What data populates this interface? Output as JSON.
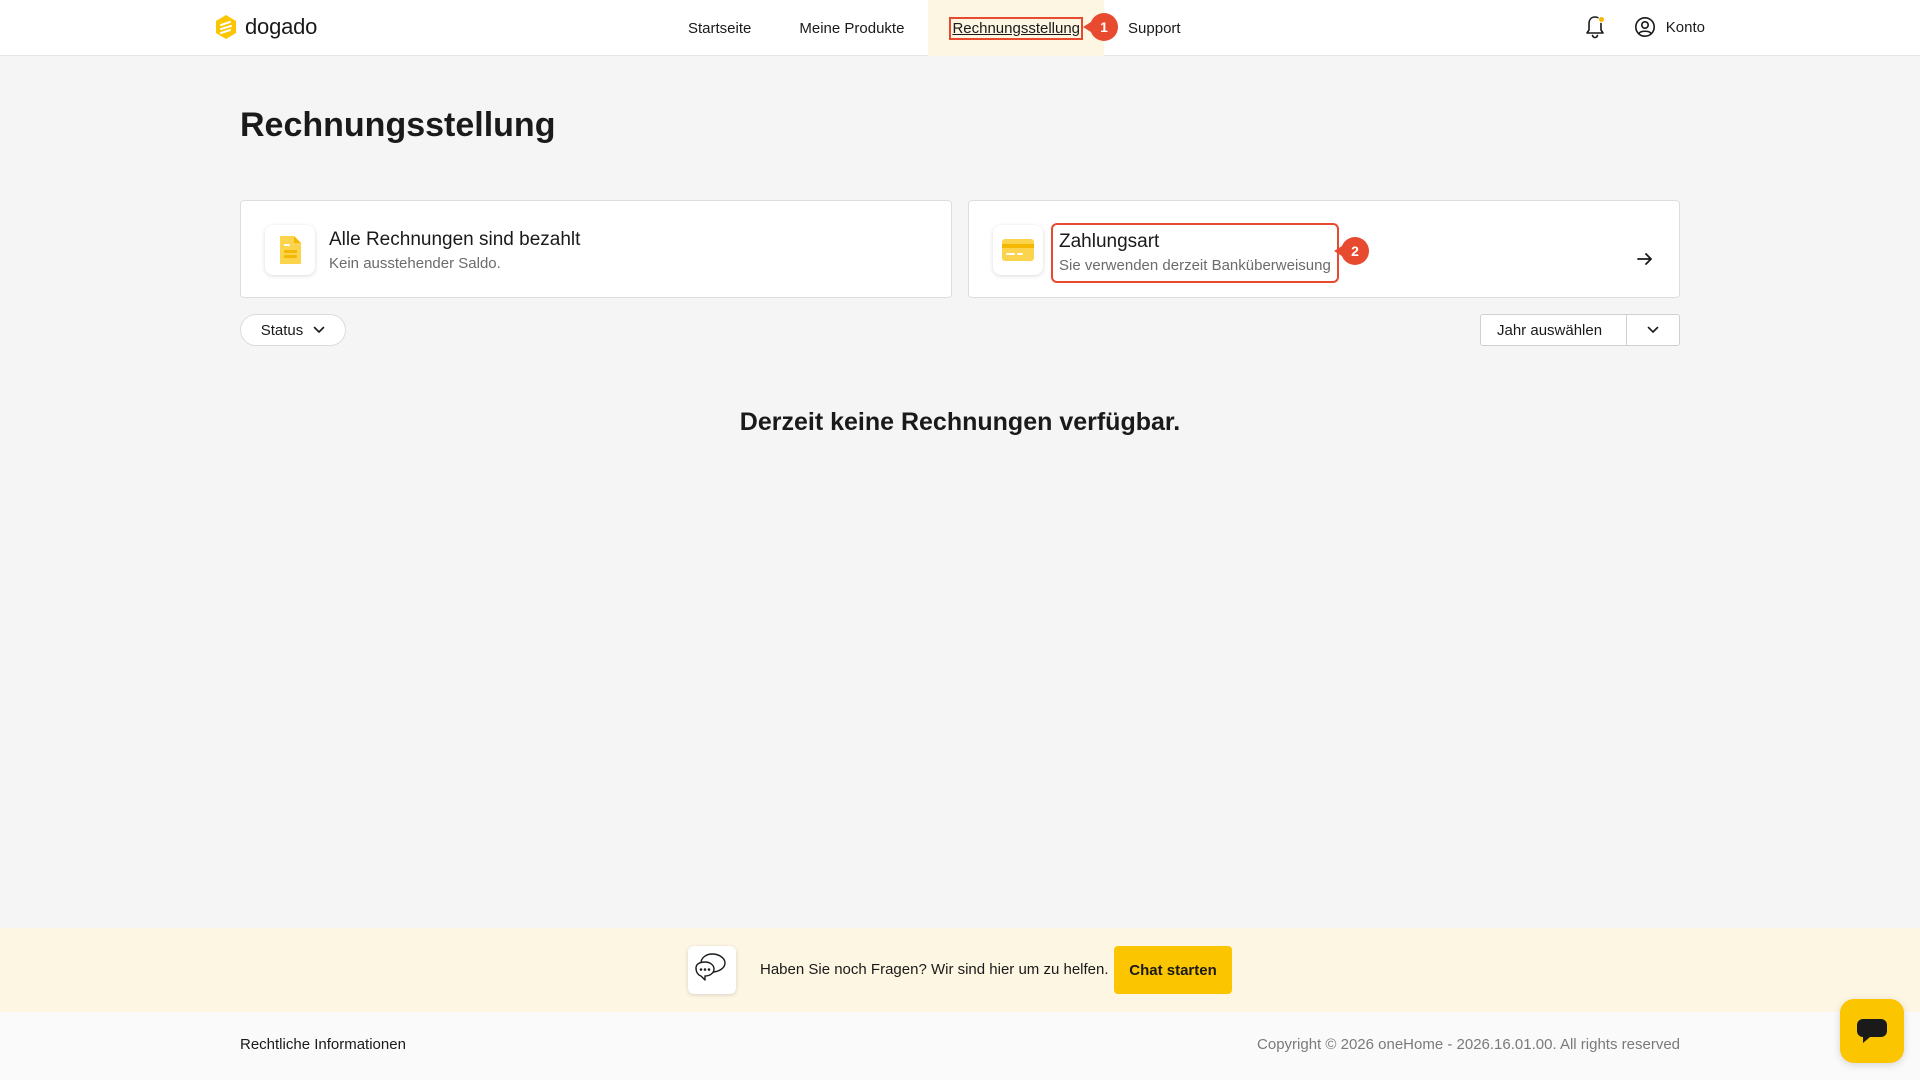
{
  "header": {
    "logo_text": "dogado",
    "nav": [
      {
        "label": "Startseite"
      },
      {
        "label": "Meine Produkte"
      },
      {
        "label": "Rechnungsstellung",
        "active": true
      },
      {
        "label": "Support"
      }
    ],
    "account_label": "Konto"
  },
  "annotations": {
    "badge_1": "1",
    "badge_2": "2"
  },
  "page": {
    "title": "Rechnungsstellung",
    "cards": [
      {
        "title": "Alle Rechnungen sind bezahlt",
        "subtitle": "Kein ausstehender Saldo.",
        "icon": "document-icon"
      },
      {
        "title": "Zahlungsart",
        "subtitle": "Sie verwenden derzeit Banküberweisung",
        "icon": "credit-card-icon"
      }
    ],
    "filters": {
      "status_label": "Status",
      "year_placeholder": "Jahr auswählen"
    },
    "empty_message": "Derzeit keine Rechnungen verfügbar."
  },
  "help": {
    "text": "Haben Sie noch Fragen? Wir sind hier um zu helfen.",
    "button_label": "Chat starten"
  },
  "footer": {
    "legal_link": "Rechtliche Informationen",
    "copyright": "Copyright © 2026 oneHome - 2026.16.01.00. All rights reserved"
  },
  "colors": {
    "accent": "#fbc500",
    "annotation": "#e84a2f",
    "active_nav_bg": "#fdf6e3"
  }
}
